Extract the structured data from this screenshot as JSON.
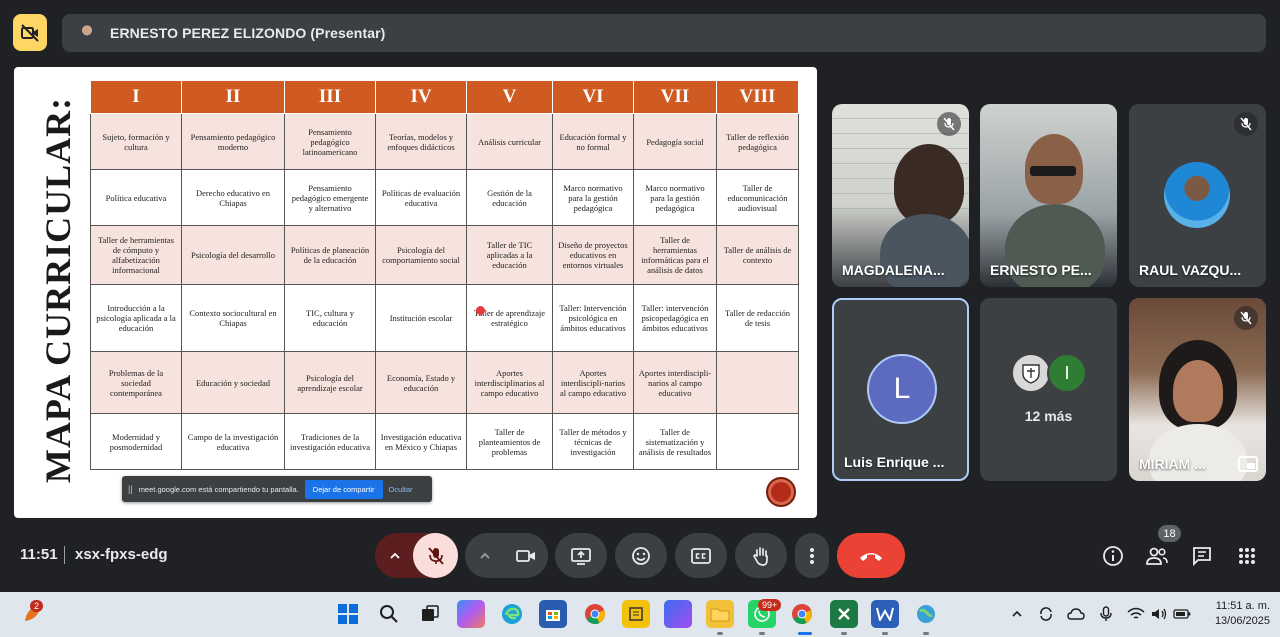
{
  "presenter_bar": {
    "name": "ERNESTO PEREZ ELIZONDO (Presentar)"
  },
  "slide": {
    "title": "MAPA CURRICULAR:",
    "headers": [
      "I",
      "II",
      "III",
      "IV",
      "V",
      "VI",
      "VII",
      "VIII"
    ],
    "rows": [
      [
        "Sujeto, formación y cultura",
        "Pensamiento pedagógico moderno",
        "Pensamiento pedagógico latinoamericano",
        "Teorías, modelos y enfoques didácticos",
        "Análisis curricular",
        "Educación formal y no formal",
        "Pedagogía social",
        "Taller de reflexión pedagógica"
      ],
      [
        "Política educativa",
        "Derecho educativo en Chiapas",
        "Pensamiento pedagógico emergente y alternativo",
        "Políticas de evaluación educativa",
        "Gestión de la educación",
        "Marco normativo para la gestión pedagógica",
        "Marco normativo para la gestión pedagógica",
        "Taller de educomunicación audiovisual"
      ],
      [
        "Taller de herramientas de cómputo y alfabetización informacional",
        "Psicología del desarrollo",
        "Políticas de planeación de la educación",
        "Psicología del comportamiento social",
        "Taller de TIC aplicadas a la educación",
        "Diseño de proyectos educativos en entornos virtuales",
        "Taller de herramientas informáticas para el análisis de datos",
        "Taller de análisis de contexto"
      ],
      [
        "Introducción a la psicología aplicada a la educación",
        "Contexto sociocultural en Chiapas",
        "TIC, cultura y educación",
        "Institución escolar",
        "Taller de aprendizaje estratégico",
        "Taller: Intervención psicológica en ámbitos educativos",
        "Taller: intervención psicopedagógica en ámbitos educativos",
        "Taller de redacción de tesis"
      ],
      [
        "Problemas de la sociedad contemporánea",
        "Educación y sociedad",
        "Psicología del aprendizaje escolar",
        "Economía, Estado y educación",
        "Aportes interdisciplinarios al campo educativo",
        "Aportes interdiscipli-narios al campo educativo",
        "Aportes interdiscipli-narios al campo educativo",
        ""
      ],
      [
        "Modernidad y posmodernidad",
        "Campo de la investigación educativa",
        "Tradiciones de la investigación educativa",
        "Investigación educativa en México y Chiapas",
        "Taller de planteamientos de problemas",
        "Taller de métodos y técnicas de investigación",
        "Taller de sistematización y análisis de resultados",
        ""
      ]
    ]
  },
  "share_notice": {
    "handle": "||",
    "text": "meet.google.com está compartiendo tu pantalla.",
    "stop_label": "Dejar de compartir",
    "hide_label": "Ocultar"
  },
  "participants": [
    {
      "name": "MAGDALENA...",
      "muted": true
    },
    {
      "name": "ERNESTO PE...",
      "muted": false
    },
    {
      "name": "RAUL VAZQU...",
      "muted": true
    },
    {
      "name": "Luis Enrique ...",
      "initial": "L",
      "muted": false
    },
    {
      "more_label": "12 más",
      "extra_initial": "I"
    },
    {
      "name": "MIRIAM ...",
      "muted": true
    }
  ],
  "footer": {
    "time": "11:51",
    "meeting_code": "xsx-fpxs-edg",
    "people_count": "18"
  },
  "taskbar": {
    "notification_badge": "2",
    "whatsapp_badge": "99+",
    "time": "11:51 a. m.",
    "date": "13/06/2025"
  },
  "colors": {
    "header_orange": "#cf5a22",
    "row_tint": "#f7e3de",
    "end_call_red": "#ea4335",
    "cam_off_yellow": "#fdd663",
    "luis_avatar": "#5c6bc0"
  }
}
